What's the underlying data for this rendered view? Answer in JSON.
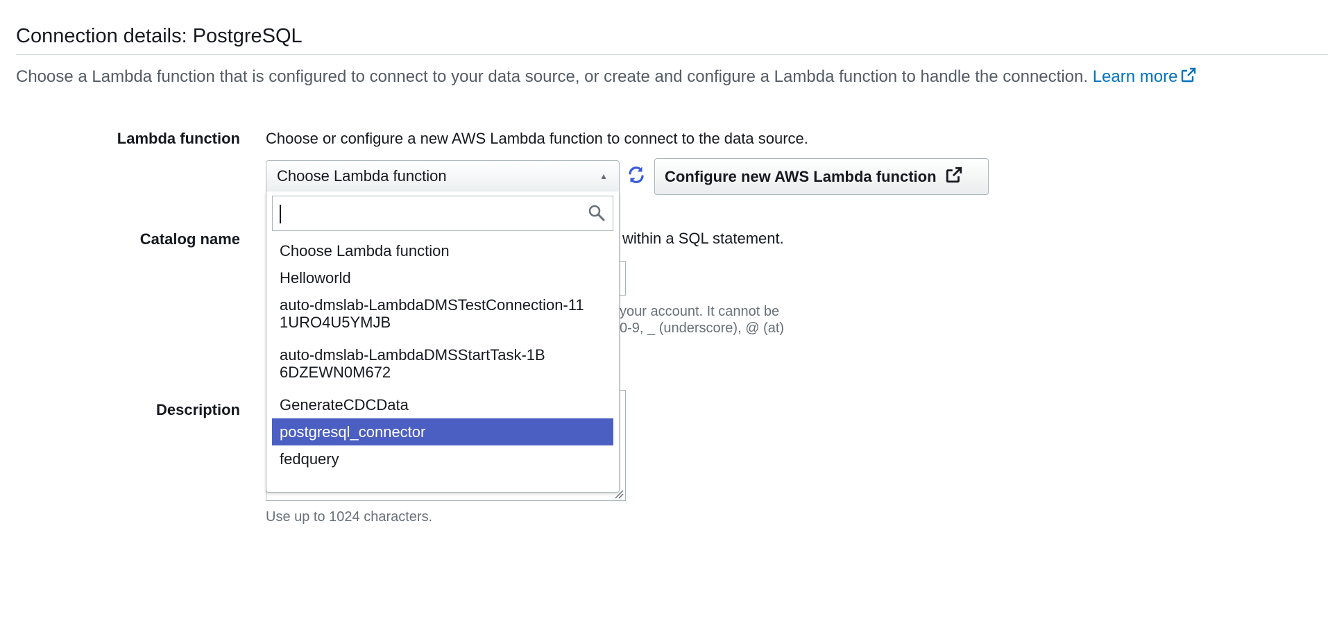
{
  "section": {
    "title": "Connection details: PostgreSQL",
    "intro": "Choose a Lambda function that is configured to connect to your data source, or create and configure a Lambda function to handle the connection.",
    "learn_more": "Learn more"
  },
  "lambda": {
    "label": "Lambda function",
    "description": "Choose or configure a new AWS Lambda function to connect to the data source.",
    "select_value": "Choose Lambda function",
    "configure_button": "Configure new AWS Lambda function",
    "search_value": "",
    "options": [
      "Choose Lambda function",
      "Helloworld",
      "auto-dmslab-LambdaDMSTestConnection-111URO4U5YMJB",
      "auto-dmslab-LambdaDMSStartTask-1B6DZEWN0M672",
      "GenerateCDCData",
      "postgresql_connector",
      "fedquery"
    ],
    "highlighted_option": "postgresql_connector"
  },
  "catalog": {
    "label": "Catalog name",
    "description_visible": "within a SQL statement.",
    "hint_line1_visible": "your account. It cannot be",
    "hint_line2_visible": "0-9, _ (underscore), @ (at)"
  },
  "description_field": {
    "label": "Description",
    "hint": "Use up to 1024 characters."
  },
  "icons": {
    "external_link": "external-link-icon",
    "refresh": "refresh-icon",
    "search": "search-icon",
    "caret": "caret-up-icon"
  },
  "colors": {
    "link": "#0073bb",
    "highlight": "#4b5fc2",
    "refresh": "#3b5bdb"
  }
}
